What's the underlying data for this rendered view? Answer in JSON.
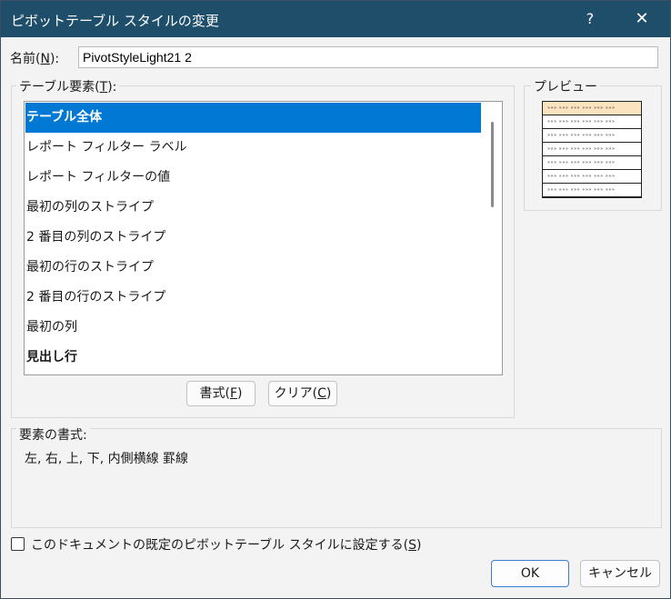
{
  "window": {
    "title": "ピボットテーブル スタイルの変更",
    "help_label": "?",
    "close_label": "✕"
  },
  "name": {
    "label_prefix": "名前(",
    "label_key": "N",
    "label_suffix": "):",
    "value": "PivotStyleLight21 2"
  },
  "elements": {
    "label_prefix": "テーブル要素(",
    "label_key": "T",
    "label_suffix": "):",
    "items": [
      {
        "label": "テーブル全体",
        "selected": true,
        "bold": true
      },
      {
        "label": "レポート フィルター ラベル",
        "selected": false,
        "bold": false
      },
      {
        "label": "レポート フィルターの値",
        "selected": false,
        "bold": false
      },
      {
        "label": "最初の列のストライプ",
        "selected": false,
        "bold": false
      },
      {
        "label": "2 番目の列のストライプ",
        "selected": false,
        "bold": false
      },
      {
        "label": "最初の行のストライプ",
        "selected": false,
        "bold": false
      },
      {
        "label": "2 番目の行のストライプ",
        "selected": false,
        "bold": false
      },
      {
        "label": "最初の列",
        "selected": false,
        "bold": false
      },
      {
        "label": "見出し行",
        "selected": false,
        "bold": true
      }
    ],
    "format_button_prefix": "書式(",
    "format_button_key": "F",
    "format_button_suffix": ")",
    "clear_button_prefix": "クリア(",
    "clear_button_key": "C",
    "clear_button_suffix": ")"
  },
  "preview": {
    "label": "プレビュー",
    "rows": 7,
    "header_color": "#fbe3c0",
    "cell_marker": "»»» »»» »»» »»» »»» »»»"
  },
  "element_format": {
    "label": "要素の書式:",
    "value": "左, 右, 上, 下, 内側横線 罫線"
  },
  "default_option": {
    "checked": false,
    "label_prefix": "このドキュメントの既定のピボットテーブル スタイルに設定する(",
    "label_key": "S",
    "label_suffix": ")"
  },
  "buttons": {
    "ok": "OK",
    "cancel": "キャンセル"
  },
  "colors": {
    "titlebar": "#1f4e6b",
    "selection": "#0078d4",
    "ok_border": "#3b7dd0"
  }
}
